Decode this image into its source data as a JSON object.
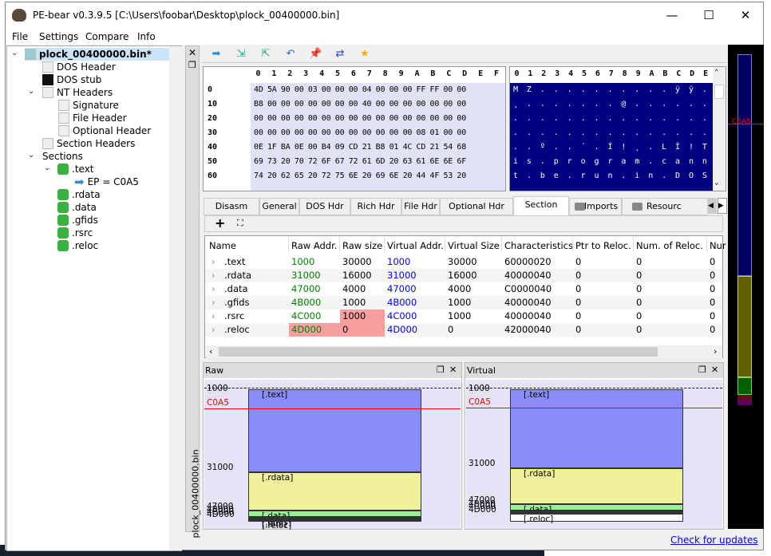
{
  "window": {
    "title": "PE-bear v0.3.9.5 [C:\\Users\\foobar\\Desktop\\plock_00400000.bin]",
    "minimize": "—",
    "maximize": "☐",
    "close": "✕"
  },
  "menu": [
    "File",
    "Settings",
    "Compare",
    "Info"
  ],
  "tree": {
    "root": "plock_00400000.bin*",
    "dos_header": "DOS Header",
    "dos_stub": "DOS stub",
    "nt_headers": "NT Headers",
    "signature": "Signature",
    "file_header": "File Header",
    "optional_header": "Optional Header",
    "section_headers": "Section Headers",
    "sections": "Sections",
    "text": ".text",
    "ep": "EP = C0A5",
    "rdata": ".rdata",
    "data": ".data",
    "gfids": ".gfids",
    "rsrc": ".rsrc",
    "reloc": ".reloc"
  },
  "dock": {
    "label": "plock_00400000.bin"
  },
  "toolbar_icons": [
    "goto-arrow-icon",
    "export-icon",
    "import-icon",
    "undo-icon",
    "pin-icon",
    "compare-icon",
    "favorite-star-icon"
  ],
  "hex": {
    "columns": [
      "0",
      "1",
      "2",
      "3",
      "4",
      "5",
      "6",
      "7",
      "8",
      "9",
      "A",
      "B",
      "C",
      "D",
      "E",
      "F"
    ],
    "rows": [
      {
        "offset": "0",
        "bytes": "4D 5A 90 00 03 00 00 00 04 00 00 00 FF FF 00 00",
        "ascii": "MZ..........ÿÿ.."
      },
      {
        "offset": "10",
        "bytes": "B8 00 00 00 00 00 00 00 40 00 00 00 00 00 00 00",
        "ascii": "¸.......@......."
      },
      {
        "offset": "20",
        "bytes": "00 00 00 00 00 00 00 00 00 00 00 00 00 00 00 00",
        "ascii": "................"
      },
      {
        "offset": "30",
        "bytes": "00 00 00 00 00 00 00 00 00 00 00 00 08 01 00 00",
        "ascii": "................"
      },
      {
        "offset": "40",
        "bytes": "0E 1F BA 0E 00 B4 09 CD 21 B8 01 4C CD 21 54 68",
        "ascii": "..º..´.Í!¸.LÍ!Th"
      },
      {
        "offset": "50",
        "bytes": "69 73 20 70 72 6F 67 72 61 6D 20 63 61 6E 6E 6F",
        "ascii": "is.program.canno"
      },
      {
        "offset": "60",
        "bytes": "74 20 62 65 20 72 75 6E 20 69 6E 20 44 4F 53 20",
        "ascii": "t.be.run.in.DOS."
      }
    ]
  },
  "tabs": [
    "Disasm",
    "General",
    "DOS Hdr",
    "Rich Hdr",
    "File Hdr",
    "Optional Hdr",
    "Section Hdrs",
    "Imports",
    "Resourc"
  ],
  "active_tab": "Section Hdrs",
  "table": {
    "headers": [
      "Name",
      "Raw Addr.",
      "Raw size",
      "Virtual Addr.",
      "Virtual Size",
      "Characteristics",
      "Ptr to Reloc.",
      "Num. of Reloc.",
      "Nur"
    ],
    "rows": [
      [
        ".text",
        "1000",
        "30000",
        "1000",
        "30000",
        "60000020",
        "0",
        "0",
        "0"
      ],
      [
        ".rdata",
        "31000",
        "16000",
        "31000",
        "16000",
        "40000040",
        "0",
        "0",
        "0"
      ],
      [
        ".data",
        "47000",
        "4000",
        "47000",
        "4000",
        "C0000040",
        "0",
        "0",
        "0"
      ],
      [
        ".gfids",
        "4B000",
        "1000",
        "4B000",
        "1000",
        "40000040",
        "0",
        "0",
        "0"
      ],
      [
        ".rsrc",
        "4C000",
        "1000",
        "4C000",
        "1000",
        "40000040",
        "0",
        "0",
        "0"
      ],
      [
        ".reloc",
        "4D000",
        "0",
        "4D000",
        "0",
        "42000040",
        "0",
        "0",
        "0"
      ]
    ],
    "colors": {
      "raw_addr": "#008000",
      "virtual_addr": "#0000ff",
      "highlight": "#f8a0a0"
    }
  },
  "raw_panel": {
    "title": "Raw",
    "ep": "C0A5",
    "marks": [
      "1000",
      "31000",
      "47000",
      "4B000",
      "4C000",
      "4D000"
    ],
    "sections": [
      ".text",
      ".rdata",
      ".data",
      ".gfids",
      ".rsrc",
      ".reloc"
    ]
  },
  "virtual_panel": {
    "title": "Virtual",
    "ep": "C0A5",
    "marks": [
      "1000",
      "31000",
      "47000",
      "4B000",
      "4C000",
      "4D000"
    ],
    "sections": [
      ".text",
      ".rdata",
      ".data",
      ".gfids",
      ".rsrc",
      ".reloc"
    ]
  },
  "map": {
    "ep": "C0A5"
  },
  "check_updates": "Check for updates"
}
